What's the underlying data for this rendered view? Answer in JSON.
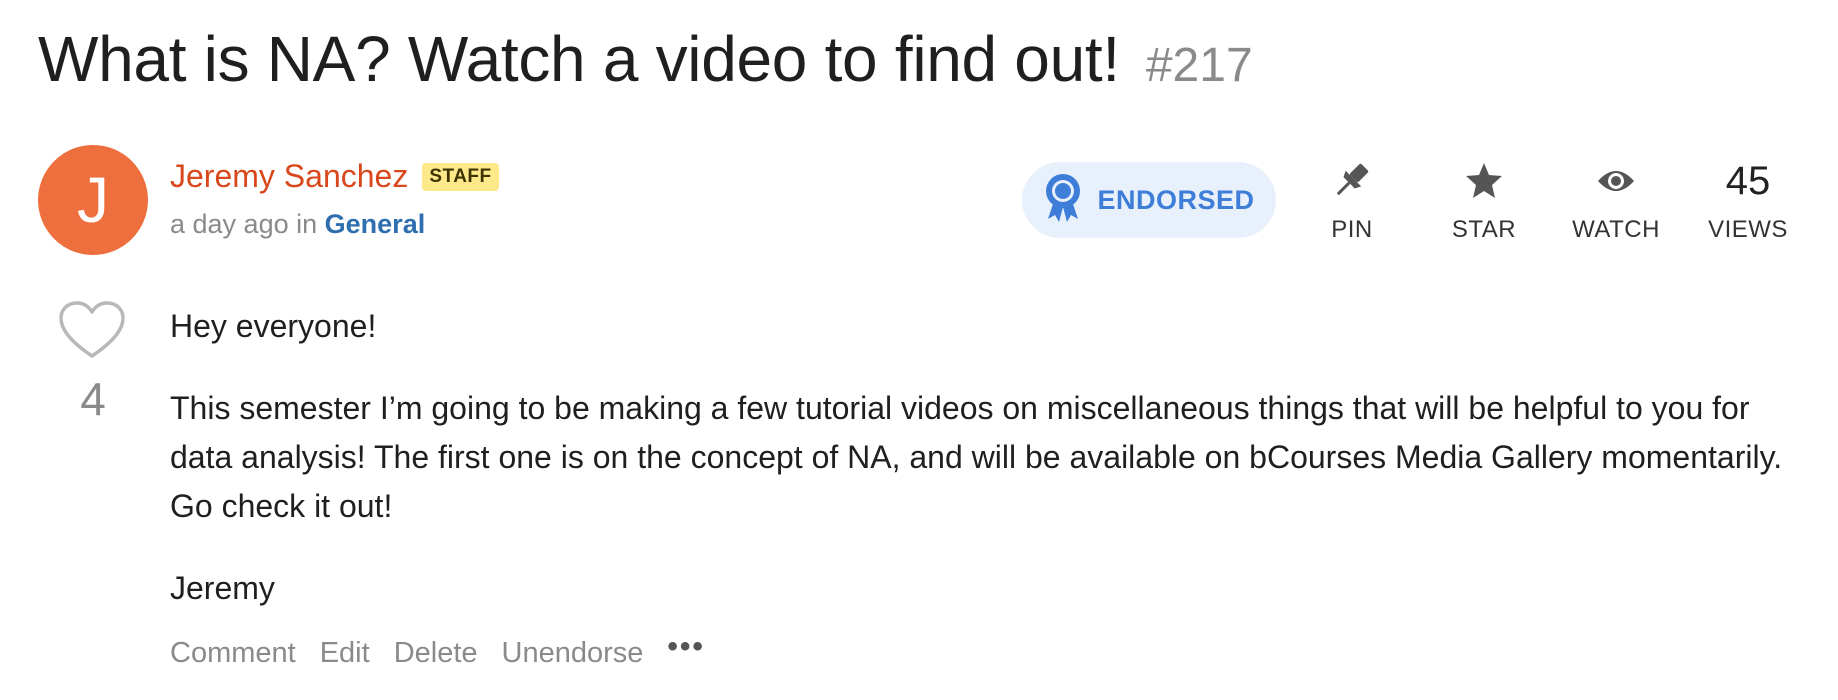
{
  "thread": {
    "title": "What is NA? Watch a video to find out!",
    "number": "#217"
  },
  "author": {
    "initial": "J",
    "name": "Jeremy Sanchez",
    "badge": "STAFF",
    "time": "a day ago",
    "in_text": "in",
    "category": "General"
  },
  "endorsed": {
    "label": "ENDORSED"
  },
  "actions": {
    "pin_label": "PIN",
    "star_label": "STAR",
    "watch_label": "WATCH",
    "views_count": "45",
    "views_label": "VIEWS"
  },
  "likes": {
    "count": "4"
  },
  "body": {
    "greeting": "Hey everyone!",
    "paragraph": "This semester I’m going to be making a few tutorial videos on miscellaneous things that will be helpful to you for data analysis! The first one is on the concept of NA, and will be available on bCourses Media Gallery momentarily. Go check it out!",
    "signature": "Jeremy"
  },
  "footer": {
    "comment": "Comment",
    "edit": "Edit",
    "delete": "Delete",
    "unendorse": "Unendorse",
    "more": "•••"
  },
  "colors": {
    "avatar": "#ee6f3e",
    "author_name": "#d9471c",
    "badge_bg": "#fde98a",
    "category": "#2f6fb0",
    "endorsed_bg": "#e8f0fc",
    "endorsed_text": "#3e7ed8"
  },
  "icons": [
    "award-icon",
    "pin-icon",
    "star-icon",
    "eye-icon",
    "heart-icon",
    "more-icon"
  ]
}
